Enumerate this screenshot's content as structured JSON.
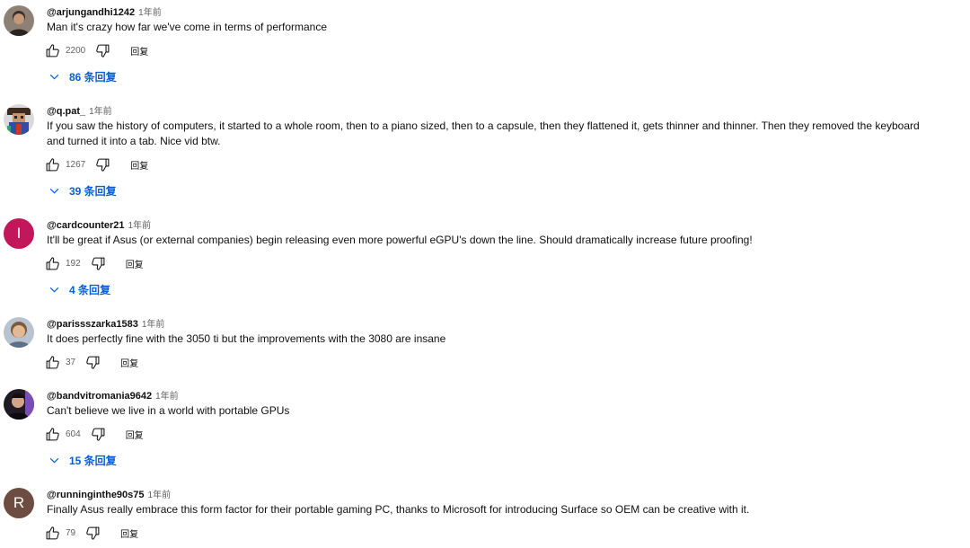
{
  "comments": [
    {
      "author": "@arjungandhi1242",
      "time": "1年前",
      "text": "Man it's crazy how far we've come in terms of performance",
      "likes": "2200",
      "reply_label": "回复",
      "replies_label": "86 条回复",
      "avatar_icon": "person-photo-avatar"
    },
    {
      "author": "@q.pat_",
      "time": "1年前",
      "text": "If you saw the history of computers, it started to a whole room, then to a piano sized, then to a capsule, then they flattened it, gets thinner and thinner. Then they removed the keyboard and turned it into a tab. Nice vid btw.",
      "likes": "1267",
      "reply_label": "回复",
      "replies_label": "39 条回复",
      "avatar_icon": "pixel-art-avatar"
    },
    {
      "author": "@cardcounter21",
      "time": "1年前",
      "text": "It'll be great if Asus (or external companies) begin releasing even more powerful eGPU's down the line. Should dramatically increase future proofing!",
      "likes": "192",
      "reply_label": "回复",
      "replies_label": "4 条回复",
      "avatar_letter": "I",
      "avatar_color": "#c2185b"
    },
    {
      "author": "@parissszarka1583",
      "time": "1年前",
      "text": "It does perfectly fine with the 3050 ti but the improvements with the 3080 are insane",
      "likes": "37",
      "reply_label": "回复",
      "avatar_icon": "person-photo-avatar"
    },
    {
      "author": "@bandvitromania9642",
      "time": "1年前",
      "text": "Can't believe we live in a world with portable GPUs",
      "likes": "604",
      "reply_label": "回复",
      "replies_label": "15 条回复",
      "avatar_icon": "person-photo-avatar"
    },
    {
      "author": "@runninginthe90s75",
      "time": "1年前",
      "text": "Finally Asus really embrace this form factor for their portable gaming PC, thanks to Microsoft for introducing Surface so OEM can be creative with it.",
      "likes": "79",
      "reply_label": "回复",
      "avatar_letter": "R",
      "avatar_color": "#6d4c41"
    }
  ],
  "colors": {
    "link_blue": "#065fd4",
    "text_primary": "#0f0f0f",
    "text_secondary": "#606060"
  }
}
